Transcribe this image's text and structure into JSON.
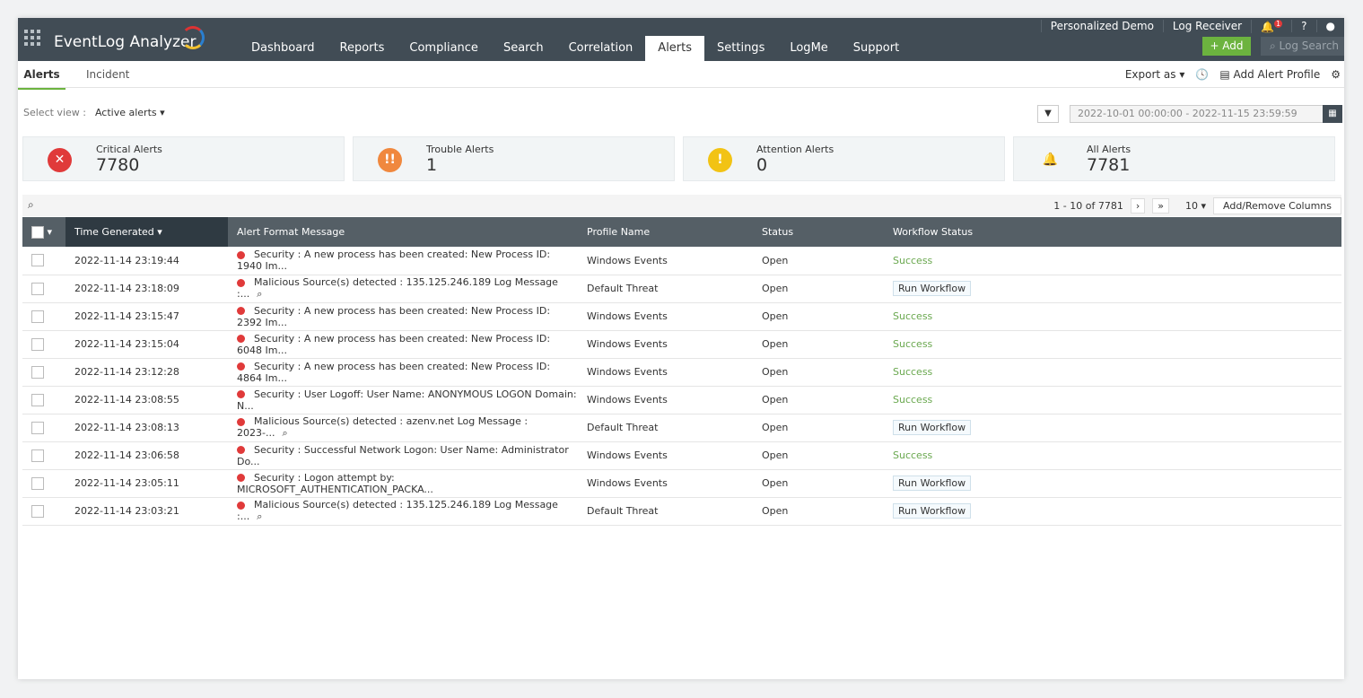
{
  "app": {
    "title": "EventLog Analyzer"
  },
  "nav": [
    "Dashboard",
    "Reports",
    "Compliance",
    "Search",
    "Correlation",
    "Alerts",
    "Settings",
    "LogMe",
    "Support"
  ],
  "top": {
    "demo": "Personalized Demo",
    "receiver": "Log Receiver",
    "notif_count": "1",
    "help": "?",
    "add": "+ Add",
    "search_placeholder": "Log Search"
  },
  "tabs": {
    "alerts": "Alerts",
    "incident": "Incident",
    "export": "Export as ▾",
    "add_profile": "Add Alert Profile"
  },
  "view": {
    "label": "Select view :",
    "value": "Active alerts ▾",
    "date_range": "2022-10-01 00:00:00 - 2022-11-15 23:59:59"
  },
  "cards": [
    {
      "title": "Critical Alerts",
      "value": "7780",
      "color": "#e03a3a",
      "icon": "x-circle-icon",
      "glyph": "✕"
    },
    {
      "title": "Trouble Alerts",
      "value": "1",
      "color": "#f0883e",
      "icon": "double-exclamation-icon",
      "glyph": "!!"
    },
    {
      "title": "Attention Alerts",
      "value": "0",
      "color": "#f2c314",
      "icon": "exclamation-icon",
      "glyph": "!"
    },
    {
      "title": "All Alerts",
      "value": "7781",
      "color": "#2e9fd8",
      "icon": "bell-icon",
      "glyph": "🔔"
    }
  ],
  "pager": {
    "range": "1 - 10 of 7781",
    "next": "›",
    "last": "»",
    "per_page": "10 ▾",
    "columns": "Add/Remove Columns"
  },
  "columns": [
    "Time Generated ▾",
    "Alert Format Message",
    "Profile Name",
    "Status",
    "Workflow Status"
  ],
  "rows": [
    [
      "2022-11-14 23:19:44",
      "Security : A new process has been created: New Process ID: 1940 Im...",
      "Windows Events",
      "Open",
      "Success"
    ],
    [
      "2022-11-14 23:18:09",
      "Malicious Source(s) detected : 135.125.246.189 Log Message :...",
      "Default Threat",
      "Open",
      "Run Workflow"
    ],
    [
      "2022-11-14 23:15:47",
      "Security : A new process has been created: New Process ID: 2392 Im...",
      "Windows Events",
      "Open",
      "Success"
    ],
    [
      "2022-11-14 23:15:04",
      "Security : A new process has been created: New Process ID: 6048 Im...",
      "Windows Events",
      "Open",
      "Success"
    ],
    [
      "2022-11-14 23:12:28",
      "Security : A new process has been created: New Process ID: 4864 Im...",
      "Windows Events",
      "Open",
      "Success"
    ],
    [
      "2022-11-14 23:08:55",
      "Security : User Logoff: User Name: ANONYMOUS LOGON Domain: N...",
      "Windows Events",
      "Open",
      "Success"
    ],
    [
      "2022-11-14 23:08:13",
      "Malicious Source(s) detected : azenv.net Log Message : 2023-...",
      "Default Threat",
      "Open",
      "Run Workflow"
    ],
    [
      "2022-11-14 23:06:58",
      "Security : Successful Network Logon: User Name: Administrator Do...",
      "Windows Events",
      "Open",
      "Success"
    ],
    [
      "2022-11-14 23:05:11",
      "Security : Logon attempt by: MICROSOFT_AUTHENTICATION_PACKA...",
      "Windows Events",
      "Open",
      "Run Workflow"
    ],
    [
      "2022-11-14 23:03:21",
      "Malicious Source(s) detected : 135.125.246.189 Log Message :...",
      "Default Threat",
      "Open",
      "Run Workflow"
    ]
  ]
}
